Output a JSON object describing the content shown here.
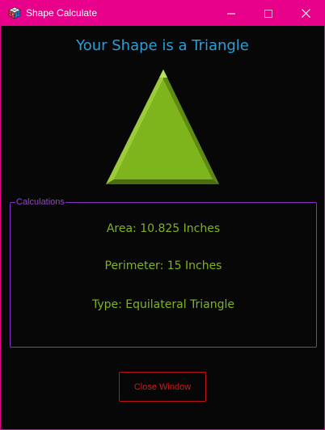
{
  "window": {
    "title": "Shape Calculate",
    "accent_color": "#e6008a",
    "icon": "rubiks-cube-icon",
    "controls": {
      "minimize_icon": "minimize-icon",
      "maximize_icon": "maximize-icon",
      "close_icon": "close-icon"
    }
  },
  "main": {
    "heading": "Your Shape is a Triangle",
    "heading_color": "#2c9ed8",
    "shape": {
      "kind": "triangle",
      "color": "#7fb51c"
    }
  },
  "calculations": {
    "legend": "Calculations",
    "area": "Area: 10.825 Inches",
    "perimeter": "Perimeter: 15 Inches",
    "type": "Type: Equilateral Triangle",
    "text_color": "#7fb51c",
    "border_color": "#8b2fc9"
  },
  "footer": {
    "close_button_label": "Close Window",
    "close_button_color": "#d41818"
  }
}
